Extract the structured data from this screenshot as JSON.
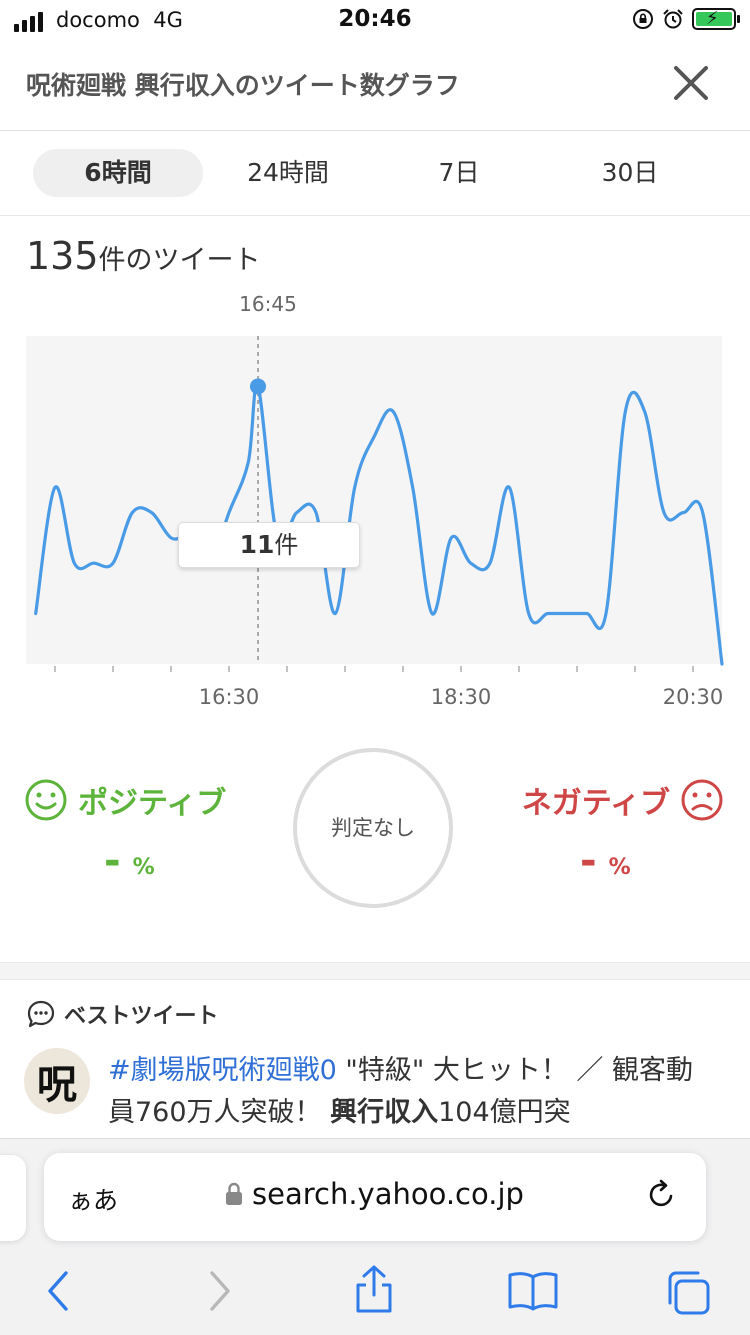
{
  "status": {
    "carrier": "docomo",
    "network": "4G",
    "time": "20:46"
  },
  "header": {
    "title": "呪術廻戦 興行収入のツイート数グラフ"
  },
  "tabs": [
    {
      "label": "6時間",
      "active": true
    },
    {
      "label": "24時間",
      "active": false
    },
    {
      "label": "7日",
      "active": false
    },
    {
      "label": "30日",
      "active": false
    }
  ],
  "summary": {
    "count": "135",
    "count_unit": "件のツイート"
  },
  "chart_data": {
    "type": "line",
    "title": "",
    "selected_time": "16:45",
    "tooltip_value": "11",
    "tooltip_unit": "件",
    "x_tick_labels": [
      "16:30",
      "18:30",
      "20:30"
    ],
    "x": [
      "14:50",
      "15:00",
      "15:10",
      "15:20",
      "15:30",
      "15:40",
      "15:50",
      "16:00",
      "16:10",
      "16:20",
      "16:30",
      "16:40",
      "16:45",
      "16:55",
      "17:05",
      "17:15",
      "17:25",
      "17:35",
      "17:45",
      "17:55",
      "18:05",
      "18:15",
      "18:25",
      "18:35",
      "18:45",
      "18:55",
      "19:05",
      "19:15",
      "19:25",
      "19:35",
      "19:45",
      "19:55",
      "20:05",
      "20:15",
      "20:25",
      "20:35",
      "20:45"
    ],
    "values": [
      2,
      7,
      4,
      4,
      4,
      6,
      6,
      5,
      5,
      4,
      6,
      8,
      11,
      5,
      6,
      6,
      2,
      7,
      9,
      10,
      7,
      2,
      5,
      4,
      4,
      7,
      2,
      2,
      2,
      2,
      2,
      10,
      10,
      6,
      6,
      6,
      0
    ],
    "ylim": [
      0,
      13
    ],
    "color": "#4a9be6"
  },
  "sentiment": {
    "positive_label": "ポジティブ",
    "positive_value": "-",
    "positive_unit": "%",
    "neutral_label": "判定なし",
    "negative_label": "ネガティブ",
    "negative_value": "-",
    "negative_unit": "%",
    "positive_color": "#5db43a",
    "negative_color": "#cf4646"
  },
  "best_tweet": {
    "section_title": "ベストツイート",
    "avatar_text": "呪",
    "hashtag": "#劇場版呪術廻戦0",
    "text_1": " \"特級\" 大ヒット！ ／ 観客動員760万人突破！ ",
    "bold_text": "興行収入",
    "text_2": "104億円突"
  },
  "browser": {
    "aa_label": "ぁあ",
    "url": "search.yahoo.co.jp"
  }
}
